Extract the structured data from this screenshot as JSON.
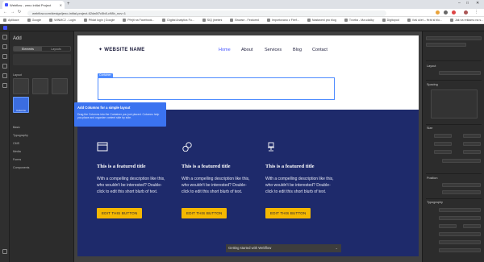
{
  "browser": {
    "tab_title": "Webflow - zeno initial Project",
    "url": "webflow.com/design/jeno-initial-project-62da6f7c5b8-c98b_nov=1",
    "bookmarks": [
      "Aplikace",
      "Google",
      "WINMC2 - Login",
      "Přidat login | Google",
      "Přejít na Facebook...",
      "Digital Analytics Fu...",
      "SIQ jineteni",
      "Browse - Featured",
      "Importovano z Firef...",
      "Nastaveni pro blog",
      "Tvorba - Ma udalky",
      "Digitopod",
      "Váš účet – Hrát si blo...",
      "Jak na reklamu na s..."
    ],
    "new_tab": "+"
  },
  "add_panel": {
    "title": "Add",
    "tabs": [
      "Elements",
      "Layouts"
    ],
    "sections": [
      "Layout",
      "Basic",
      "Typography",
      "CMS",
      "Media",
      "Forms",
      "Components"
    ],
    "selected_tile": "Columns"
  },
  "site": {
    "logo": "WEBSITE NAME",
    "nav": [
      "Home",
      "About",
      "Services",
      "Blog",
      "Contact"
    ],
    "container_tag": "Container",
    "features": [
      {
        "title": "This is a featured title",
        "desc": "With a compelling description like this, who wouldn't be interested? Double-click to edit this short blurb of text.",
        "button": "EDIT THIS BUTTON"
      },
      {
        "title": "This is a featured title",
        "desc": "With a compelling description like this, who wouldn't be interested? Double-click to edit this short blurb of text.",
        "button": "EDIT THIS BUTTON"
      },
      {
        "title": "This is a featured title",
        "desc": "With a compelling description like this, who wouldn't be interested? Double-click to edit this short blurb of text.",
        "button": "EDIT THIS BUTTON"
      }
    ]
  },
  "tooltip": {
    "title": "Add Columns for a simple layout",
    "body": "Drag the Columns into the Container you just placed. Columns help you place and organize content side by side."
  },
  "getting_started": "Getting started with Webflow",
  "right_panel": {
    "sections": [
      "Layout",
      "Spacing",
      "Size",
      "Position",
      "Typography"
    ]
  },
  "colors": {
    "accent": "#4353ff",
    "dark_section": "#1e2a6b",
    "button": "#f5b800",
    "tooltip": "#3b73f0"
  }
}
